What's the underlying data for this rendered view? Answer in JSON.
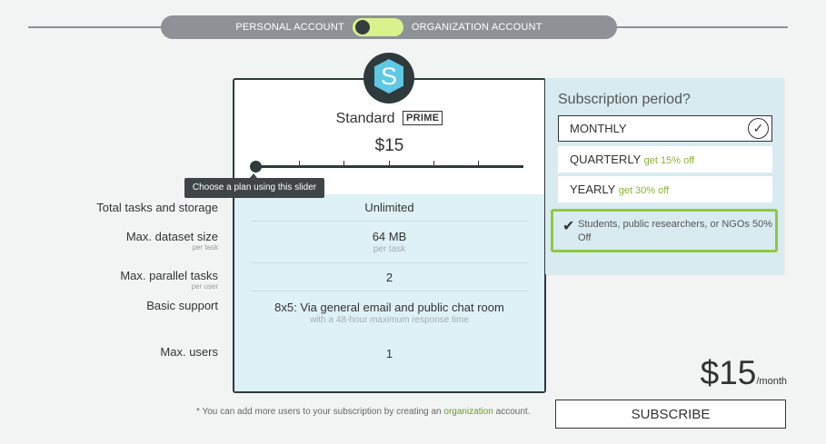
{
  "account_toggle": {
    "personal_label": "PERSONAL ACCOUNT",
    "organization_label": "ORGANIZATION ACCOUNT"
  },
  "plan": {
    "name": "Standard",
    "badge": "PRIME",
    "price": "$15",
    "logo_letter": "S",
    "slider_position": 0
  },
  "tooltip": "Choose a plan using this slider",
  "features": [
    {
      "label": "Total tasks and storage",
      "label_sub": "",
      "value": "Unlimited",
      "value_sub": ""
    },
    {
      "label": "Max. dataset size",
      "label_sub": "per task",
      "value": "64 MB",
      "value_sub": "per task"
    },
    {
      "label": "Max. parallel tasks",
      "label_sub": "per user",
      "value": "2",
      "value_sub": ""
    },
    {
      "label": "Basic support",
      "label_sub": "",
      "value": "8x5: Via general email and public chat room",
      "value_sub": "with a 48-hour maximum response time"
    },
    {
      "label": "Max. users",
      "label_sub": "",
      "value": "1",
      "value_sub": ""
    }
  ],
  "subscription": {
    "title": "Subscription period?",
    "options": [
      {
        "label": "MONTHLY",
        "discount": "",
        "selected": true
      },
      {
        "label": "QUARTERLY",
        "discount": "get 15% off",
        "selected": false
      },
      {
        "label": "YEARLY",
        "discount": "get 30% off",
        "selected": false
      }
    ],
    "discount_checkbox": {
      "label": "Students, public researchers, or NGOs 50% Off",
      "checked": true
    }
  },
  "total": {
    "amount": "$15",
    "period": "/month"
  },
  "footnote": {
    "prefix": "* You can add more users to your subscription by creating an",
    "link": "organization",
    "suffix": "account."
  },
  "subscribe_label": "SUBSCRIBE",
  "colors": {
    "accent_green": "#8fc93e",
    "dark": "#2f3a3c",
    "logo_blue": "#5fc8e4",
    "panel_blue": "#d8ebf0"
  }
}
